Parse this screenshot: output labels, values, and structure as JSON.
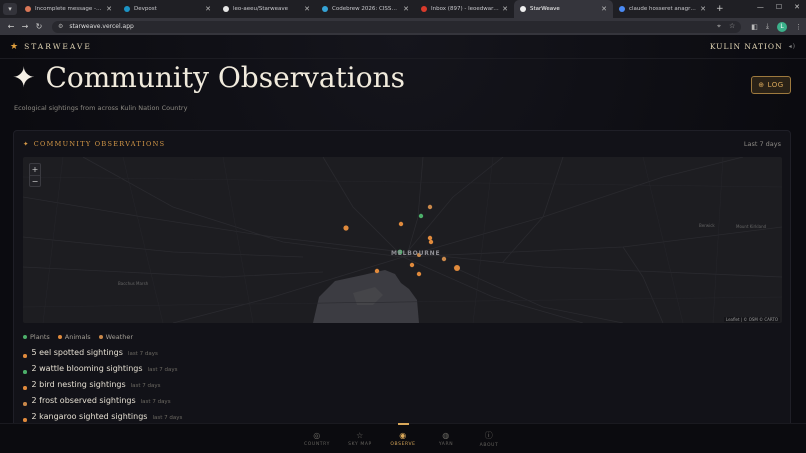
{
  "browser": {
    "tabs": [
      {
        "label": "Incomplete message - Claude",
        "color": "#d97757",
        "active": false
      },
      {
        "label": "Devpost",
        "color": "#1c93c4",
        "active": false
      },
      {
        "label": "leo-aeeu/Starweave",
        "color": "#e6e6e6",
        "active": false
      },
      {
        "label": "Codebrew 2026: CISSA's annua",
        "color": "#35a3d6",
        "active": false
      },
      {
        "label": "Inbox (897) - leoedwardsoffici",
        "color": "#d93a2b",
        "active": false
      },
      {
        "label": "StarWeave",
        "color": "#f0f0f0",
        "active": true
      },
      {
        "label": "claude hosseret anagram - Goo",
        "color": "#4a8af4",
        "active": false
      }
    ],
    "url": "starweave.vercel.app",
    "profile_initial": "L"
  },
  "header": {
    "brand": "STARWEAVE",
    "nation": "KULIN NATION"
  },
  "page": {
    "title": "Community Observations",
    "subtitle": "Ecological sightings from across Kulin Nation Country",
    "log_button": "LOG"
  },
  "panel": {
    "heading": "COMMUNITY OBSERVATIONS",
    "range": "Last 7 days",
    "map": {
      "city_label": "MELBOURNE",
      "place_labels": [
        "Bacchus Marsh",
        "Berwick",
        "Mount Kirkland"
      ],
      "attribution": "Leaflet | © OSM © CARTO",
      "zoom_in": "+",
      "zoom_out": "−"
    },
    "legend": [
      {
        "label": "Plants",
        "color": "#4caf6a"
      },
      {
        "label": "Animals",
        "color": "#e08a3c"
      },
      {
        "label": "Weather",
        "color": "#c9884a"
      }
    ],
    "sightings": [
      {
        "text": "5 eel spotted sightings",
        "when": "last 7 days",
        "color": "#e08a3c"
      },
      {
        "text": "2 wattle blooming sightings",
        "when": "last 7 days",
        "color": "#4caf6a"
      },
      {
        "text": "2 bird nesting sightings",
        "when": "last 7 days",
        "color": "#e08a3c"
      },
      {
        "text": "2 frost observed sightings",
        "when": "last 7 days",
        "color": "#c9884a"
      },
      {
        "text": "2 kangaroo sighted sightings",
        "when": "last 7 days",
        "color": "#e08a3c"
      }
    ]
  },
  "bottom_nav": [
    {
      "label": "COUNTRY",
      "icon": "compass-icon",
      "glyph": "◎",
      "active": false
    },
    {
      "label": "SKY MAP",
      "icon": "star-icon",
      "glyph": "☆",
      "active": false
    },
    {
      "label": "OBSERVE",
      "icon": "eye-icon",
      "glyph": "◉",
      "active": true
    },
    {
      "label": "YARN",
      "icon": "chat-icon",
      "glyph": "◍",
      "active": false
    },
    {
      "label": "ABOUT",
      "icon": "info-icon",
      "glyph": "ⓘ",
      "active": false
    }
  ]
}
